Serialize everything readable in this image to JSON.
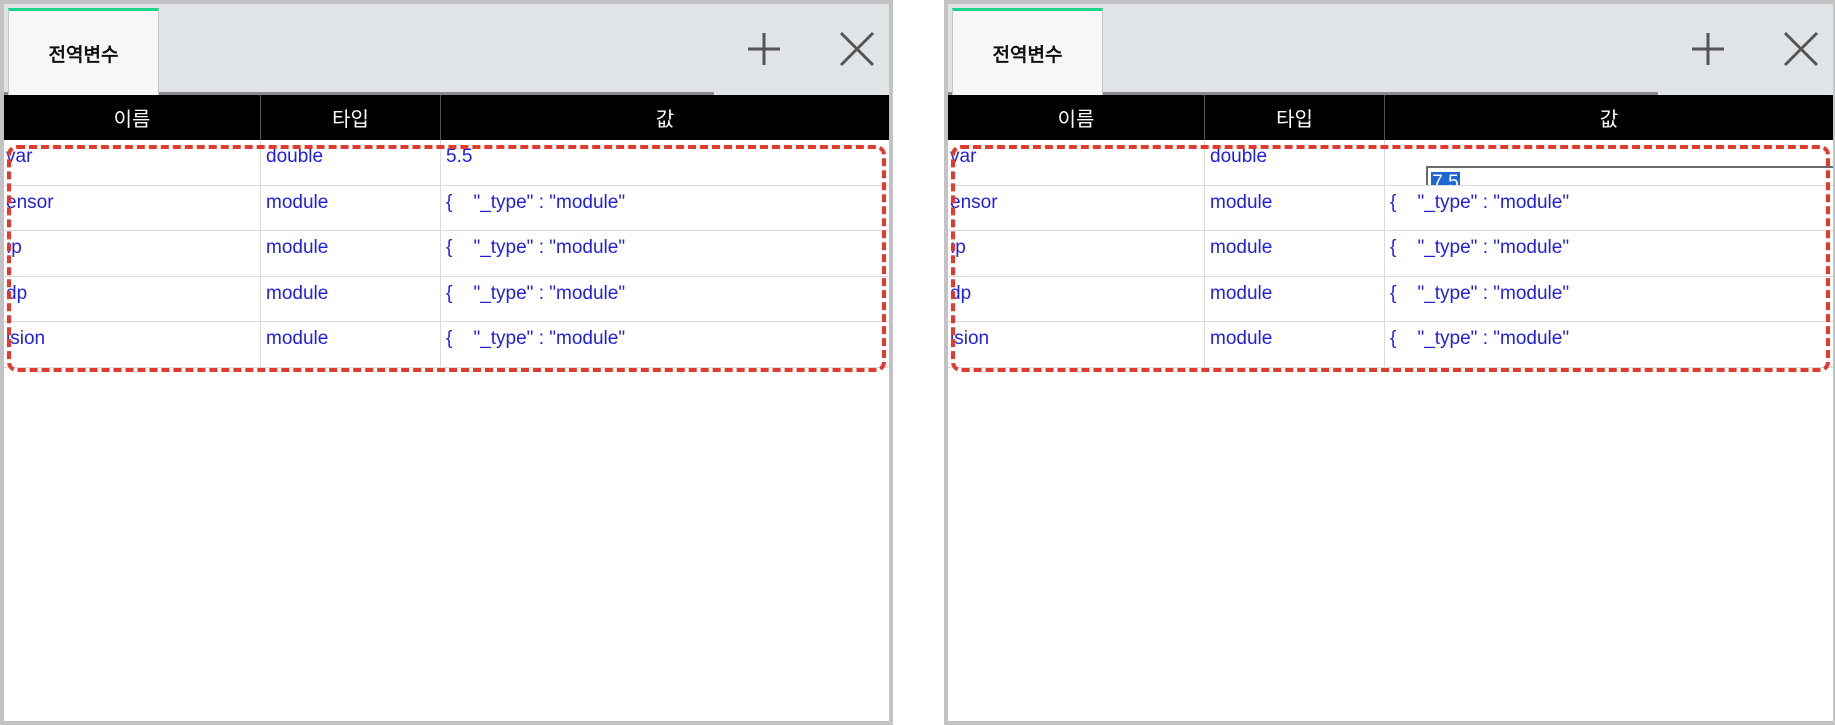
{
  "left_panel": {
    "tab_label": "전역변수",
    "columns": [
      "이름",
      "타입",
      "값"
    ],
    "rows": [
      {
        "name": "var",
        "type": "double",
        "value": "5.5"
      },
      {
        "name": "ensor",
        "type": "module",
        "value": "{    \"_type\" : \"module\""
      },
      {
        "name": ":p",
        "type": "module",
        "value": "{    \"_type\" : \"module\""
      },
      {
        "name": "dp",
        "type": "module",
        "value": "{    \"_type\" : \"module\""
      },
      {
        "name": "ision",
        "type": "module",
        "value": "{    \"_type\" : \"module\""
      }
    ]
  },
  "right_panel": {
    "tab_label": "전역변수",
    "columns": [
      "이름",
      "타입",
      "값"
    ],
    "rows": [
      {
        "name": "var",
        "type": "double",
        "value": "7.5"
      },
      {
        "name": "ensor",
        "type": "module",
        "value": "{    \"_type\" : \"module\""
      },
      {
        "name": ":p",
        "type": "module",
        "value": "{    \"_type\" : \"module\""
      },
      {
        "name": "dp",
        "type": "module",
        "value": "{    \"_type\" : \"module\""
      },
      {
        "name": "ision",
        "type": "module",
        "value": "{    \"_type\" : \"module\""
      }
    ]
  },
  "icons": {
    "add": "plus-icon",
    "close": "close-icon"
  },
  "colors": {
    "tab_accent": "#1ed58c",
    "header_bg": "#000000",
    "cell_text": "#1e1ee6",
    "highlight": "#e43a2e",
    "selection": "#1e66d6"
  }
}
